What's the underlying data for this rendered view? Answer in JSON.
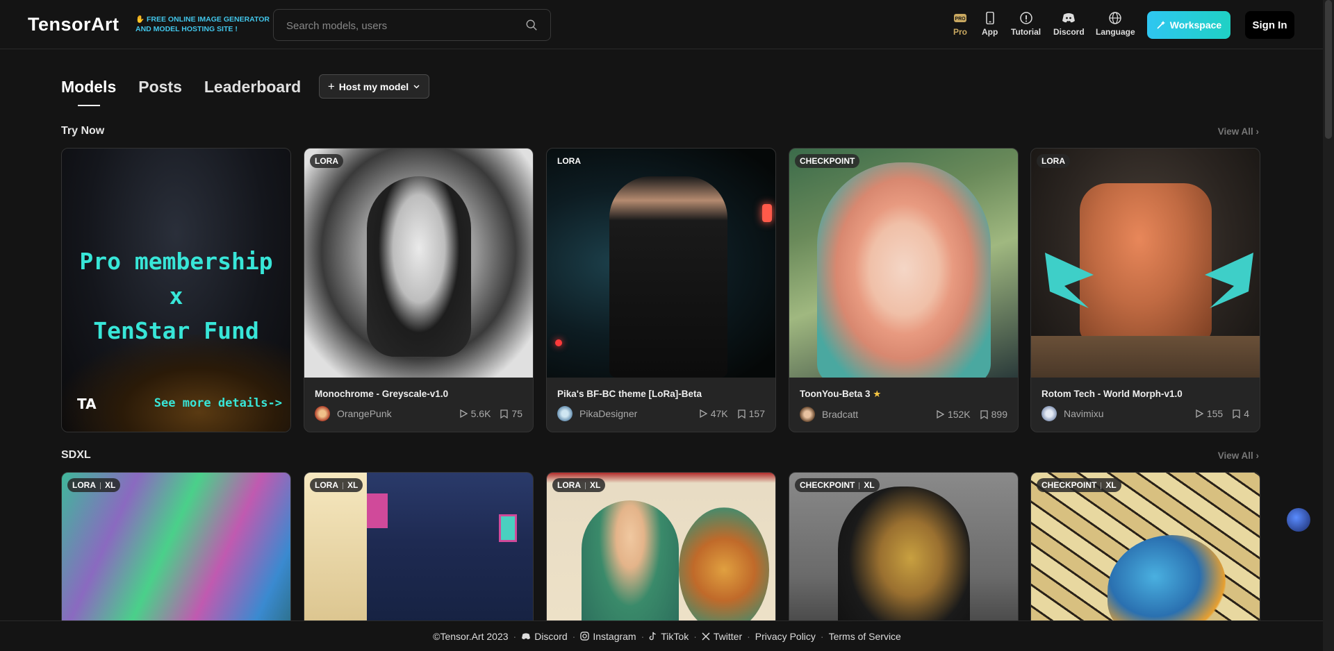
{
  "header": {
    "logo": "TensorArt",
    "promo_line1": "FREE ONLINE IMAGE GENERATOR",
    "promo_line2": "AND MODEL HOSTING SITE !",
    "search_placeholder": "Search models, users",
    "nav": {
      "pro": "Pro",
      "app": "App",
      "tutorial": "Tutorial",
      "discord": "Discord",
      "language": "Language"
    },
    "workspace_label": "Workspace",
    "signin_label": "Sign In"
  },
  "tabs": {
    "models": "Models",
    "posts": "Posts",
    "leaderboard": "Leaderboard",
    "host_label": "Host my model"
  },
  "sections": {
    "try_now": "Try Now",
    "sdxl": "SDXL",
    "view_all": "View All"
  },
  "promo_card": {
    "line1": "Pro membership",
    "line2": "x",
    "line3": "TenStar Fund",
    "cta": "See more details->",
    "mark": "TA"
  },
  "try_now_cards": [
    {
      "badge": "LORA",
      "name": "Monochrome - Greyscale-v1.0",
      "author": "OrangePunk",
      "runs": "5.6K",
      "saves": "75"
    },
    {
      "badge": "LORA",
      "name": "Pika's BF-BC theme [LoRa]-Beta",
      "author": "PikaDesigner",
      "runs": "47K",
      "saves": "157"
    },
    {
      "badge": "CHECKPOINT",
      "name": "ToonYou-Beta 3",
      "author": "Bradcatt",
      "runs": "152K",
      "saves": "899"
    },
    {
      "badge": "LORA",
      "name": "Rotom Tech - World Morph-v1.0",
      "author": "Navimixu",
      "runs": "155",
      "saves": "4"
    }
  ],
  "sdxl_cards": [
    {
      "badge": "LORA",
      "badge2": "XL"
    },
    {
      "badge": "LORA",
      "badge2": "XL"
    },
    {
      "badge": "LORA",
      "badge2": "XL"
    },
    {
      "badge": "CHECKPOINT",
      "badge2": "XL"
    },
    {
      "badge": "CHECKPOINT",
      "badge2": "XL"
    }
  ],
  "footer": {
    "copyright": "©Tensor.Art 2023",
    "discord": "Discord",
    "instagram": "Instagram",
    "tiktok": "TikTok",
    "twitter": "Twitter",
    "privacy": "Privacy Policy",
    "terms": "Terms of Service"
  },
  "colors": {
    "accent": "#2fc6f1",
    "pro_gold": "#c9a860",
    "background": "#141414",
    "card": "#252525"
  }
}
